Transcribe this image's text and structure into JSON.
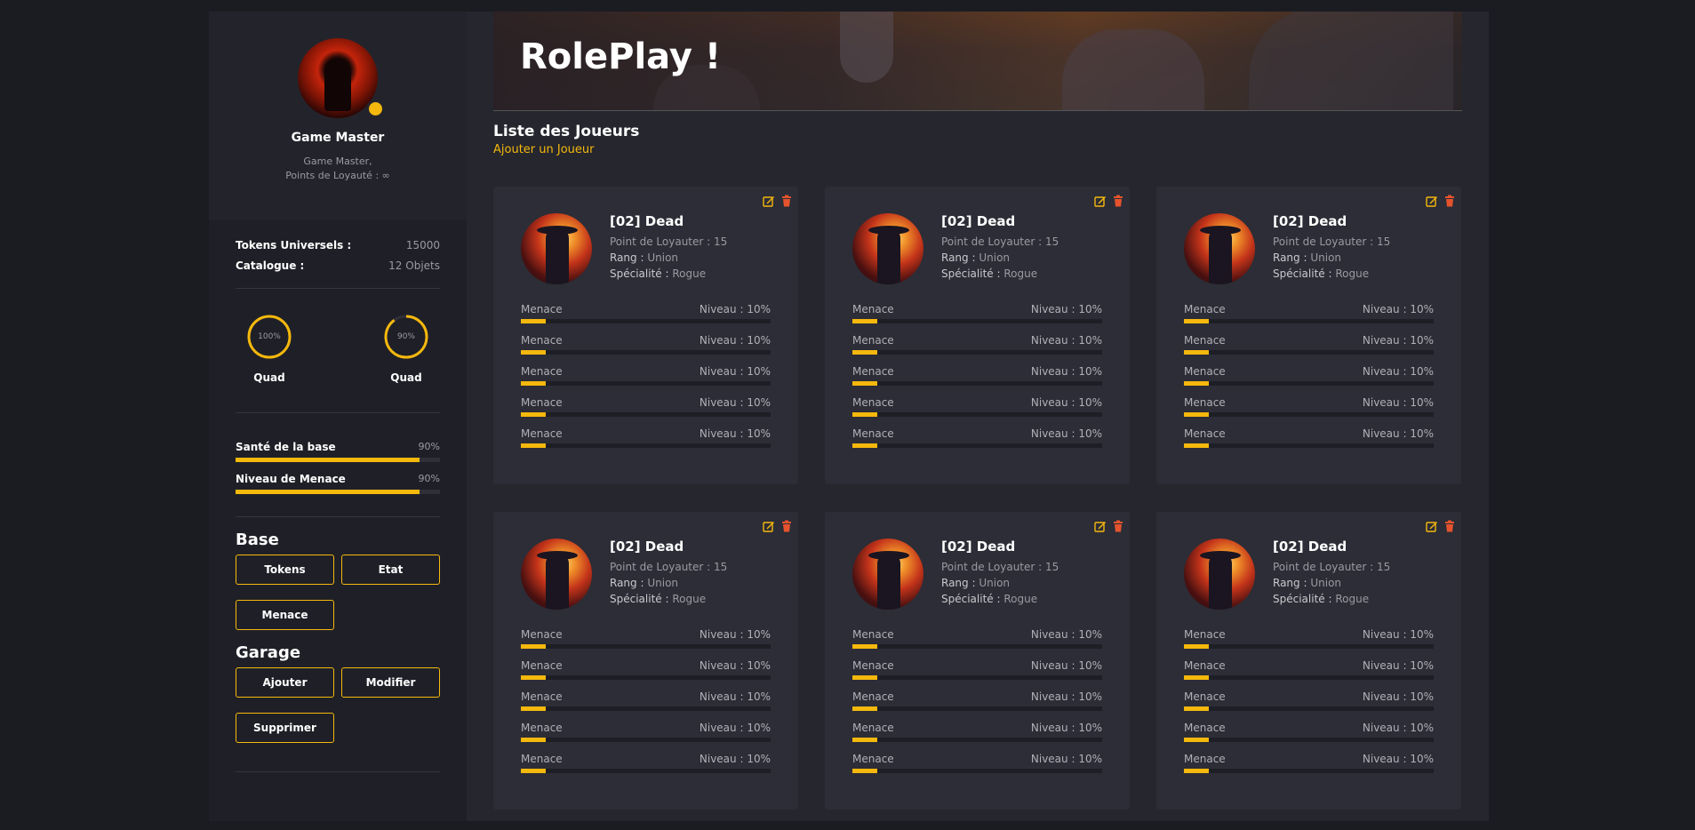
{
  "sidebar": {
    "profile": {
      "name": "Game Master",
      "role": "Game Master,",
      "loyalty": "Points de Loyauté : ∞"
    },
    "info": [
      {
        "label": "Tokens Universels :",
        "value": "15000"
      },
      {
        "label": "Catalogue :",
        "value": "12 Objets"
      }
    ],
    "rings": [
      {
        "percent_text": "100%",
        "value": 1.0,
        "label": "Quad"
      },
      {
        "percent_text": "90%",
        "value": 0.9,
        "label": "Quad"
      }
    ],
    "stats": [
      {
        "label": "Santé de la base",
        "value_text": "90%",
        "value": 0.9
      },
      {
        "label": "Niveau de Menace",
        "value_text": "90%",
        "value": 0.9
      }
    ],
    "base": {
      "title": "Base",
      "buttons": [
        "Tokens",
        "Etat",
        "Menace"
      ]
    },
    "garage": {
      "title": "Garage",
      "buttons": [
        "Ajouter",
        "Modifier",
        "Supprimer"
      ]
    }
  },
  "main": {
    "banner_title": "RolePlay !",
    "list_title": "Liste des Joueurs",
    "add_player": "Ajouter un Joueur"
  },
  "players": [
    {
      "name": "[02] Dead",
      "loyalty": "Point de Loyauter : 15",
      "rank_label": "Rang :",
      "rank": "Union",
      "spec_label": "Spécialité :",
      "spec": "Rogue",
      "stats": [
        {
          "label": "Menace",
          "level_text": "Niveau : 10%",
          "value": 0.1
        },
        {
          "label": "Menace",
          "level_text": "Niveau : 10%",
          "value": 0.1
        },
        {
          "label": "Menace",
          "level_text": "Niveau : 10%",
          "value": 0.1
        },
        {
          "label": "Menace",
          "level_text": "Niveau : 10%",
          "value": 0.1
        },
        {
          "label": "Menace",
          "level_text": "Niveau : 10%",
          "value": 0.1
        }
      ]
    },
    {
      "name": "[02] Dead",
      "loyalty": "Point de Loyauter : 15",
      "rank_label": "Rang :",
      "rank": "Union",
      "spec_label": "Spécialité :",
      "spec": "Rogue",
      "stats": [
        {
          "label": "Menace",
          "level_text": "Niveau : 10%",
          "value": 0.1
        },
        {
          "label": "Menace",
          "level_text": "Niveau : 10%",
          "value": 0.1
        },
        {
          "label": "Menace",
          "level_text": "Niveau : 10%",
          "value": 0.1
        },
        {
          "label": "Menace",
          "level_text": "Niveau : 10%",
          "value": 0.1
        },
        {
          "label": "Menace",
          "level_text": "Niveau : 10%",
          "value": 0.1
        }
      ]
    },
    {
      "name": "[02] Dead",
      "loyalty": "Point de Loyauter : 15",
      "rank_label": "Rang :",
      "rank": "Union",
      "spec_label": "Spécialité :",
      "spec": "Rogue",
      "stats": [
        {
          "label": "Menace",
          "level_text": "Niveau : 10%",
          "value": 0.1
        },
        {
          "label": "Menace",
          "level_text": "Niveau : 10%",
          "value": 0.1
        },
        {
          "label": "Menace",
          "level_text": "Niveau : 10%",
          "value": 0.1
        },
        {
          "label": "Menace",
          "level_text": "Niveau : 10%",
          "value": 0.1
        },
        {
          "label": "Menace",
          "level_text": "Niveau : 10%",
          "value": 0.1
        }
      ]
    },
    {
      "name": "[02] Dead",
      "loyalty": "Point de Loyauter : 15",
      "rank_label": "Rang :",
      "rank": "Union",
      "spec_label": "Spécialité :",
      "spec": "Rogue",
      "stats": [
        {
          "label": "Menace",
          "level_text": "Niveau : 10%",
          "value": 0.1
        },
        {
          "label": "Menace",
          "level_text": "Niveau : 10%",
          "value": 0.1
        },
        {
          "label": "Menace",
          "level_text": "Niveau : 10%",
          "value": 0.1
        },
        {
          "label": "Menace",
          "level_text": "Niveau : 10%",
          "value": 0.1
        },
        {
          "label": "Menace",
          "level_text": "Niveau : 10%",
          "value": 0.1
        }
      ]
    },
    {
      "name": "[02] Dead",
      "loyalty": "Point de Loyauter : 15",
      "rank_label": "Rang :",
      "rank": "Union",
      "spec_label": "Spécialité :",
      "spec": "Rogue",
      "stats": [
        {
          "label": "Menace",
          "level_text": "Niveau : 10%",
          "value": 0.1
        },
        {
          "label": "Menace",
          "level_text": "Niveau : 10%",
          "value": 0.1
        },
        {
          "label": "Menace",
          "level_text": "Niveau : 10%",
          "value": 0.1
        },
        {
          "label": "Menace",
          "level_text": "Niveau : 10%",
          "value": 0.1
        },
        {
          "label": "Menace",
          "level_text": "Niveau : 10%",
          "value": 0.1
        }
      ]
    },
    {
      "name": "[02] Dead",
      "loyalty": "Point de Loyauter : 15",
      "rank_label": "Rang :",
      "rank": "Union",
      "spec_label": "Spécialité :",
      "spec": "Rogue",
      "stats": [
        {
          "label": "Menace",
          "level_text": "Niveau : 10%",
          "value": 0.1
        },
        {
          "label": "Menace",
          "level_text": "Niveau : 10%",
          "value": 0.1
        },
        {
          "label": "Menace",
          "level_text": "Niveau : 10%",
          "value": 0.1
        },
        {
          "label": "Menace",
          "level_text": "Niveau : 10%",
          "value": 0.1
        },
        {
          "label": "Menace",
          "level_text": "Niveau : 10%",
          "value": 0.1
        }
      ]
    }
  ],
  "colors": {
    "accent": "#f5b80d",
    "delete": "#e5532d",
    "background": "#1b1c22",
    "card": "#2c2d36"
  },
  "icons": {
    "edit": "edit-icon",
    "delete": "trash-icon"
  }
}
